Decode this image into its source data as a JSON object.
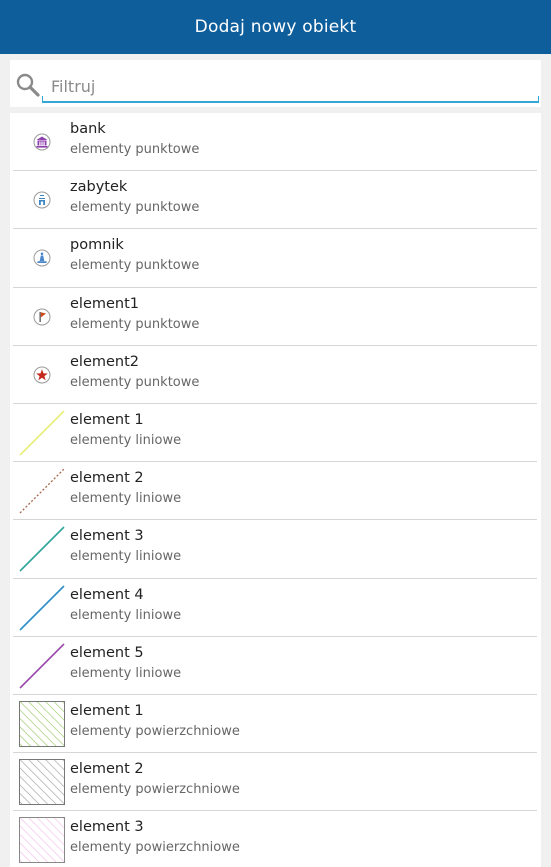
{
  "header": {
    "title": "Dodaj nowy obiekt"
  },
  "search": {
    "placeholder": "Filtruj",
    "value": ""
  },
  "items": [
    {
      "name": "bank",
      "category": "elementy punktowe",
      "icon": "bank-marker-icon"
    },
    {
      "name": "zabytek",
      "category": "elementy punktowe",
      "icon": "monument-marker-icon"
    },
    {
      "name": "pomnik",
      "category": "elementy punktowe",
      "icon": "statue-marker-icon"
    },
    {
      "name": "element1",
      "category": "elementy punktowe",
      "icon": "flag-marker-icon"
    },
    {
      "name": "element2",
      "category": "elementy punktowe",
      "icon": "star-marker-icon"
    },
    {
      "name": "element 1",
      "category": "elementy liniowe",
      "icon": "line-yellow-icon"
    },
    {
      "name": "element 2",
      "category": "elementy liniowe",
      "icon": "line-dotted-brown-icon"
    },
    {
      "name": "element 3",
      "category": "elementy liniowe",
      "icon": "line-teal-icon"
    },
    {
      "name": "element 4",
      "category": "elementy liniowe",
      "icon": "line-blue-icon"
    },
    {
      "name": "element 5",
      "category": "elementy liniowe",
      "icon": "line-purple-icon"
    },
    {
      "name": "element 1",
      "category": "elementy powierzchniowe",
      "icon": "hatch-green-icon"
    },
    {
      "name": "element 2",
      "category": "elementy powierzchniowe",
      "icon": "hatch-gray-icon"
    },
    {
      "name": "element 3",
      "category": "elementy powierzchniowe",
      "icon": "hatch-pink-icon"
    }
  ],
  "colors": {
    "header_bg": "#0f5e9c",
    "search_accent": "#33a6d6",
    "bank": "#8e3fae",
    "zabytek": "#3d86c6",
    "pomnik": "#4a86c8",
    "flag": "#d04a1a",
    "star": "#c4281c",
    "line_yellow": "#e8f07a",
    "line_brown": "#a8674a",
    "line_teal": "#2fa59a",
    "line_blue": "#2a8fc8",
    "line_purple": "#9a4aa8",
    "hatch_green": "#8fc45a",
    "hatch_gray": "#9a9a9a",
    "hatch_pink": "#f2b8e6"
  }
}
